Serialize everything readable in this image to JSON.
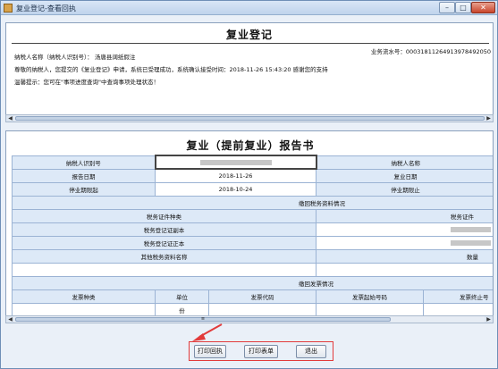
{
  "window": {
    "title": "复业登记-查看回执",
    "min_glyph": "–",
    "max_glyph": "□",
    "close_glyph": "✕"
  },
  "receipt": {
    "title": "复业登记",
    "serial_label": "业务流水号：",
    "serial_value": "00031811264913978492050",
    "taxpayer_line": "纳税人名称（纳税人识别号）：    汤唐县阔纸假注",
    "message_line": "尊敬的纳税人，您提交的《复业登记》申请，系统已受理成功，系统确认接受时间：2018-11-26    15:43:20    感谢您的支持",
    "tip_line": "温馨提示：您可在\"事项进度查询\"中查询事项处理状态！"
  },
  "report": {
    "title": "复业（提前复业）报告书",
    "taxpayer_id_label": "纳税人识别号",
    "taxpayer_name_label": "纳税人名称",
    "report_date_label": "报告日期",
    "report_date_value": "2018-11-26",
    "resume_date_label": "复业日期",
    "suspend_start_label": "停业期限起",
    "suspend_start_value": "2018-10-24",
    "suspend_end_label": "停业期限止",
    "tax_docs_section": "缴回税务资料情况",
    "tax_doc_type_label": "税务证件种类",
    "tax_doc_label_right": "税务证件",
    "reg_copy_label": "税务登记证副本",
    "reg_original_label": "税务登记证正本",
    "other_docs_label": "其他税务资料名称",
    "quantity_label": "数量",
    "invoice_section": "缴回发票情况",
    "invoice_type_label": "发票种类",
    "unit_label": "单位",
    "invoice_code_label": "发票代码",
    "invoice_start_label": "发票起始号码",
    "invoice_end_label": "发票终止号",
    "unit_value": "份"
  },
  "scroll": {
    "left_glyph": "◀",
    "right_glyph": "▶",
    "thumb_glyph": "≡"
  },
  "actions": {
    "print_receipt": "打印回执",
    "print_form": "打印表单",
    "exit": "退出"
  },
  "colors": {
    "highlight": "#e23b3b",
    "label_cell": "#dde9f7"
  }
}
